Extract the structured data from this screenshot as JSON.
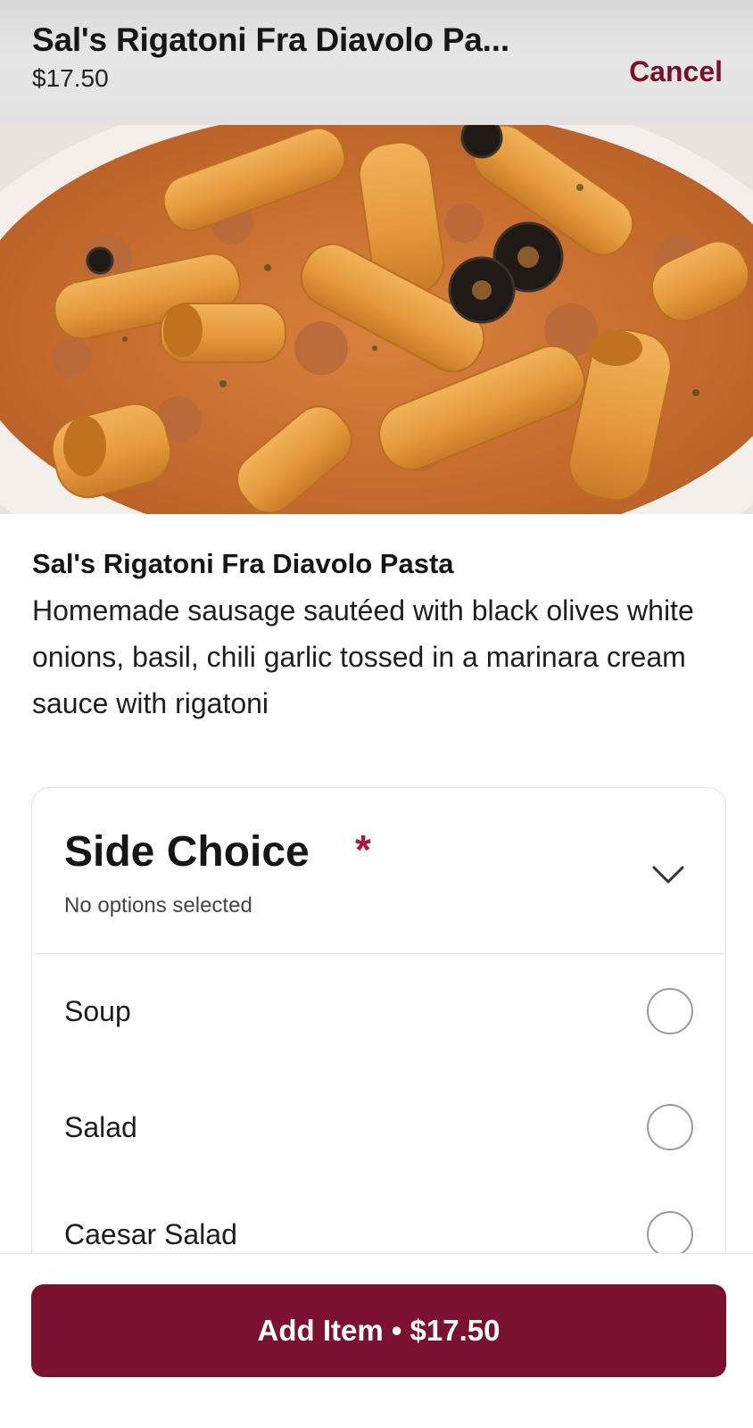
{
  "header": {
    "title": "Sal's Rigatoni Fra Diavolo Pa...",
    "price": "$17.50",
    "cancel_label": "Cancel"
  },
  "photo": {
    "subject": "rigatoni pasta with sausage, black olives and marinara cream sauce"
  },
  "item": {
    "name": "Sal's Rigatoni Fra Diavolo Pasta",
    "description": "Homemade sausage sautéed with black olives white onions, basil, chili garlic tossed in a marinara cream sauce with rigatoni"
  },
  "side_choice": {
    "title": "Side Choice",
    "required_marker": "*",
    "subtitle": "No options selected",
    "options": [
      {
        "label": "Soup",
        "selected": false
      },
      {
        "label": "Salad",
        "selected": false
      },
      {
        "label": "Caesar Salad",
        "selected": false
      }
    ]
  },
  "footer": {
    "add_button_label": "Add Item • $17.50"
  },
  "colors": {
    "brand": "#7b1131",
    "required_star": "#b0133f",
    "header_bg": "#e2e2e2"
  }
}
